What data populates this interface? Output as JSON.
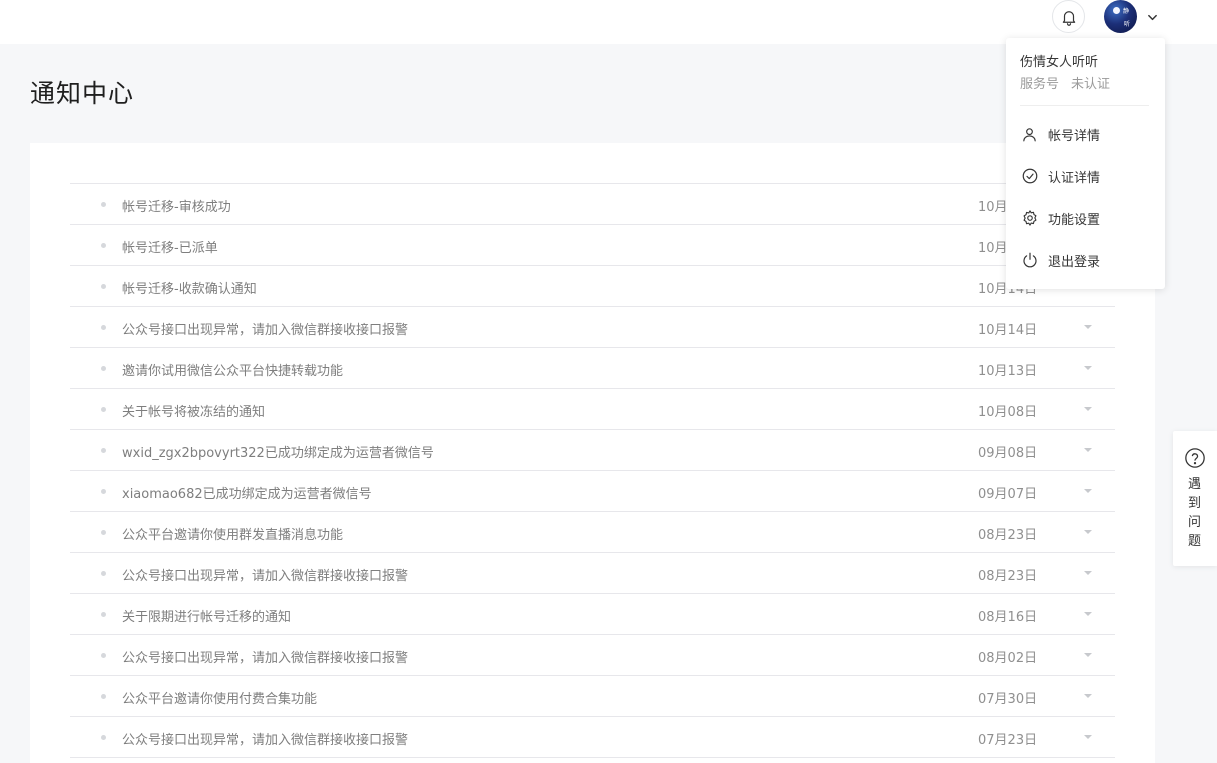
{
  "header": {
    "icons": {
      "bell": "bell-icon",
      "chevron": "chevron-down-icon"
    },
    "avatar_text": [
      "静",
      "听"
    ]
  },
  "page": {
    "title": "通知中心"
  },
  "notifications": [
    {
      "title": "帐号迁移-审核成功",
      "date": "10月"
    },
    {
      "title": "帐号迁移-已派单",
      "date": "10月"
    },
    {
      "title": "帐号迁移-收款确认通知",
      "date": "10月14日"
    },
    {
      "title": "公众号接口出现异常，请加入微信群接收接口报警",
      "date": "10月14日"
    },
    {
      "title": "邀请你试用微信公众平台快捷转载功能",
      "date": "10月13日"
    },
    {
      "title": "关于帐号将被冻结的通知",
      "date": "10月08日"
    },
    {
      "title": "wxid_zgx2bpovyrt322已成功绑定成为运营者微信号",
      "date": "09月08日"
    },
    {
      "title": "xiaomao682已成功绑定成为运营者微信号",
      "date": "09月07日"
    },
    {
      "title": "公众平台邀请你使用群发直播消息功能",
      "date": "08月23日"
    },
    {
      "title": "公众号接口出现异常，请加入微信群接收接口报警",
      "date": "08月23日"
    },
    {
      "title": "关于限期进行帐号迁移的通知",
      "date": "08月16日"
    },
    {
      "title": "公众号接口出现异常，请加入微信群接收接口报警",
      "date": "08月02日"
    },
    {
      "title": "公众平台邀请你使用付费合集功能",
      "date": "07月30日"
    },
    {
      "title": "公众号接口出现异常，请加入微信群接收接口报警",
      "date": "07月23日"
    }
  ],
  "account_menu": {
    "name": "伤情女人听听",
    "type": "服务号",
    "status": "未认证",
    "items": [
      {
        "label": "帐号详情",
        "icon": "user-icon"
      },
      {
        "label": "认证详情",
        "icon": "check-circle-icon"
      },
      {
        "label": "功能设置",
        "icon": "gear-icon"
      },
      {
        "label": "退出登录",
        "icon": "power-icon"
      }
    ]
  },
  "help": {
    "label": "遇到问题",
    "icon": "question-circle-icon"
  },
  "colors": {
    "background": "#f6f7f9",
    "card": "#ffffff",
    "divider": "#e7e7eb",
    "muted_text": "#7e7e7e"
  }
}
